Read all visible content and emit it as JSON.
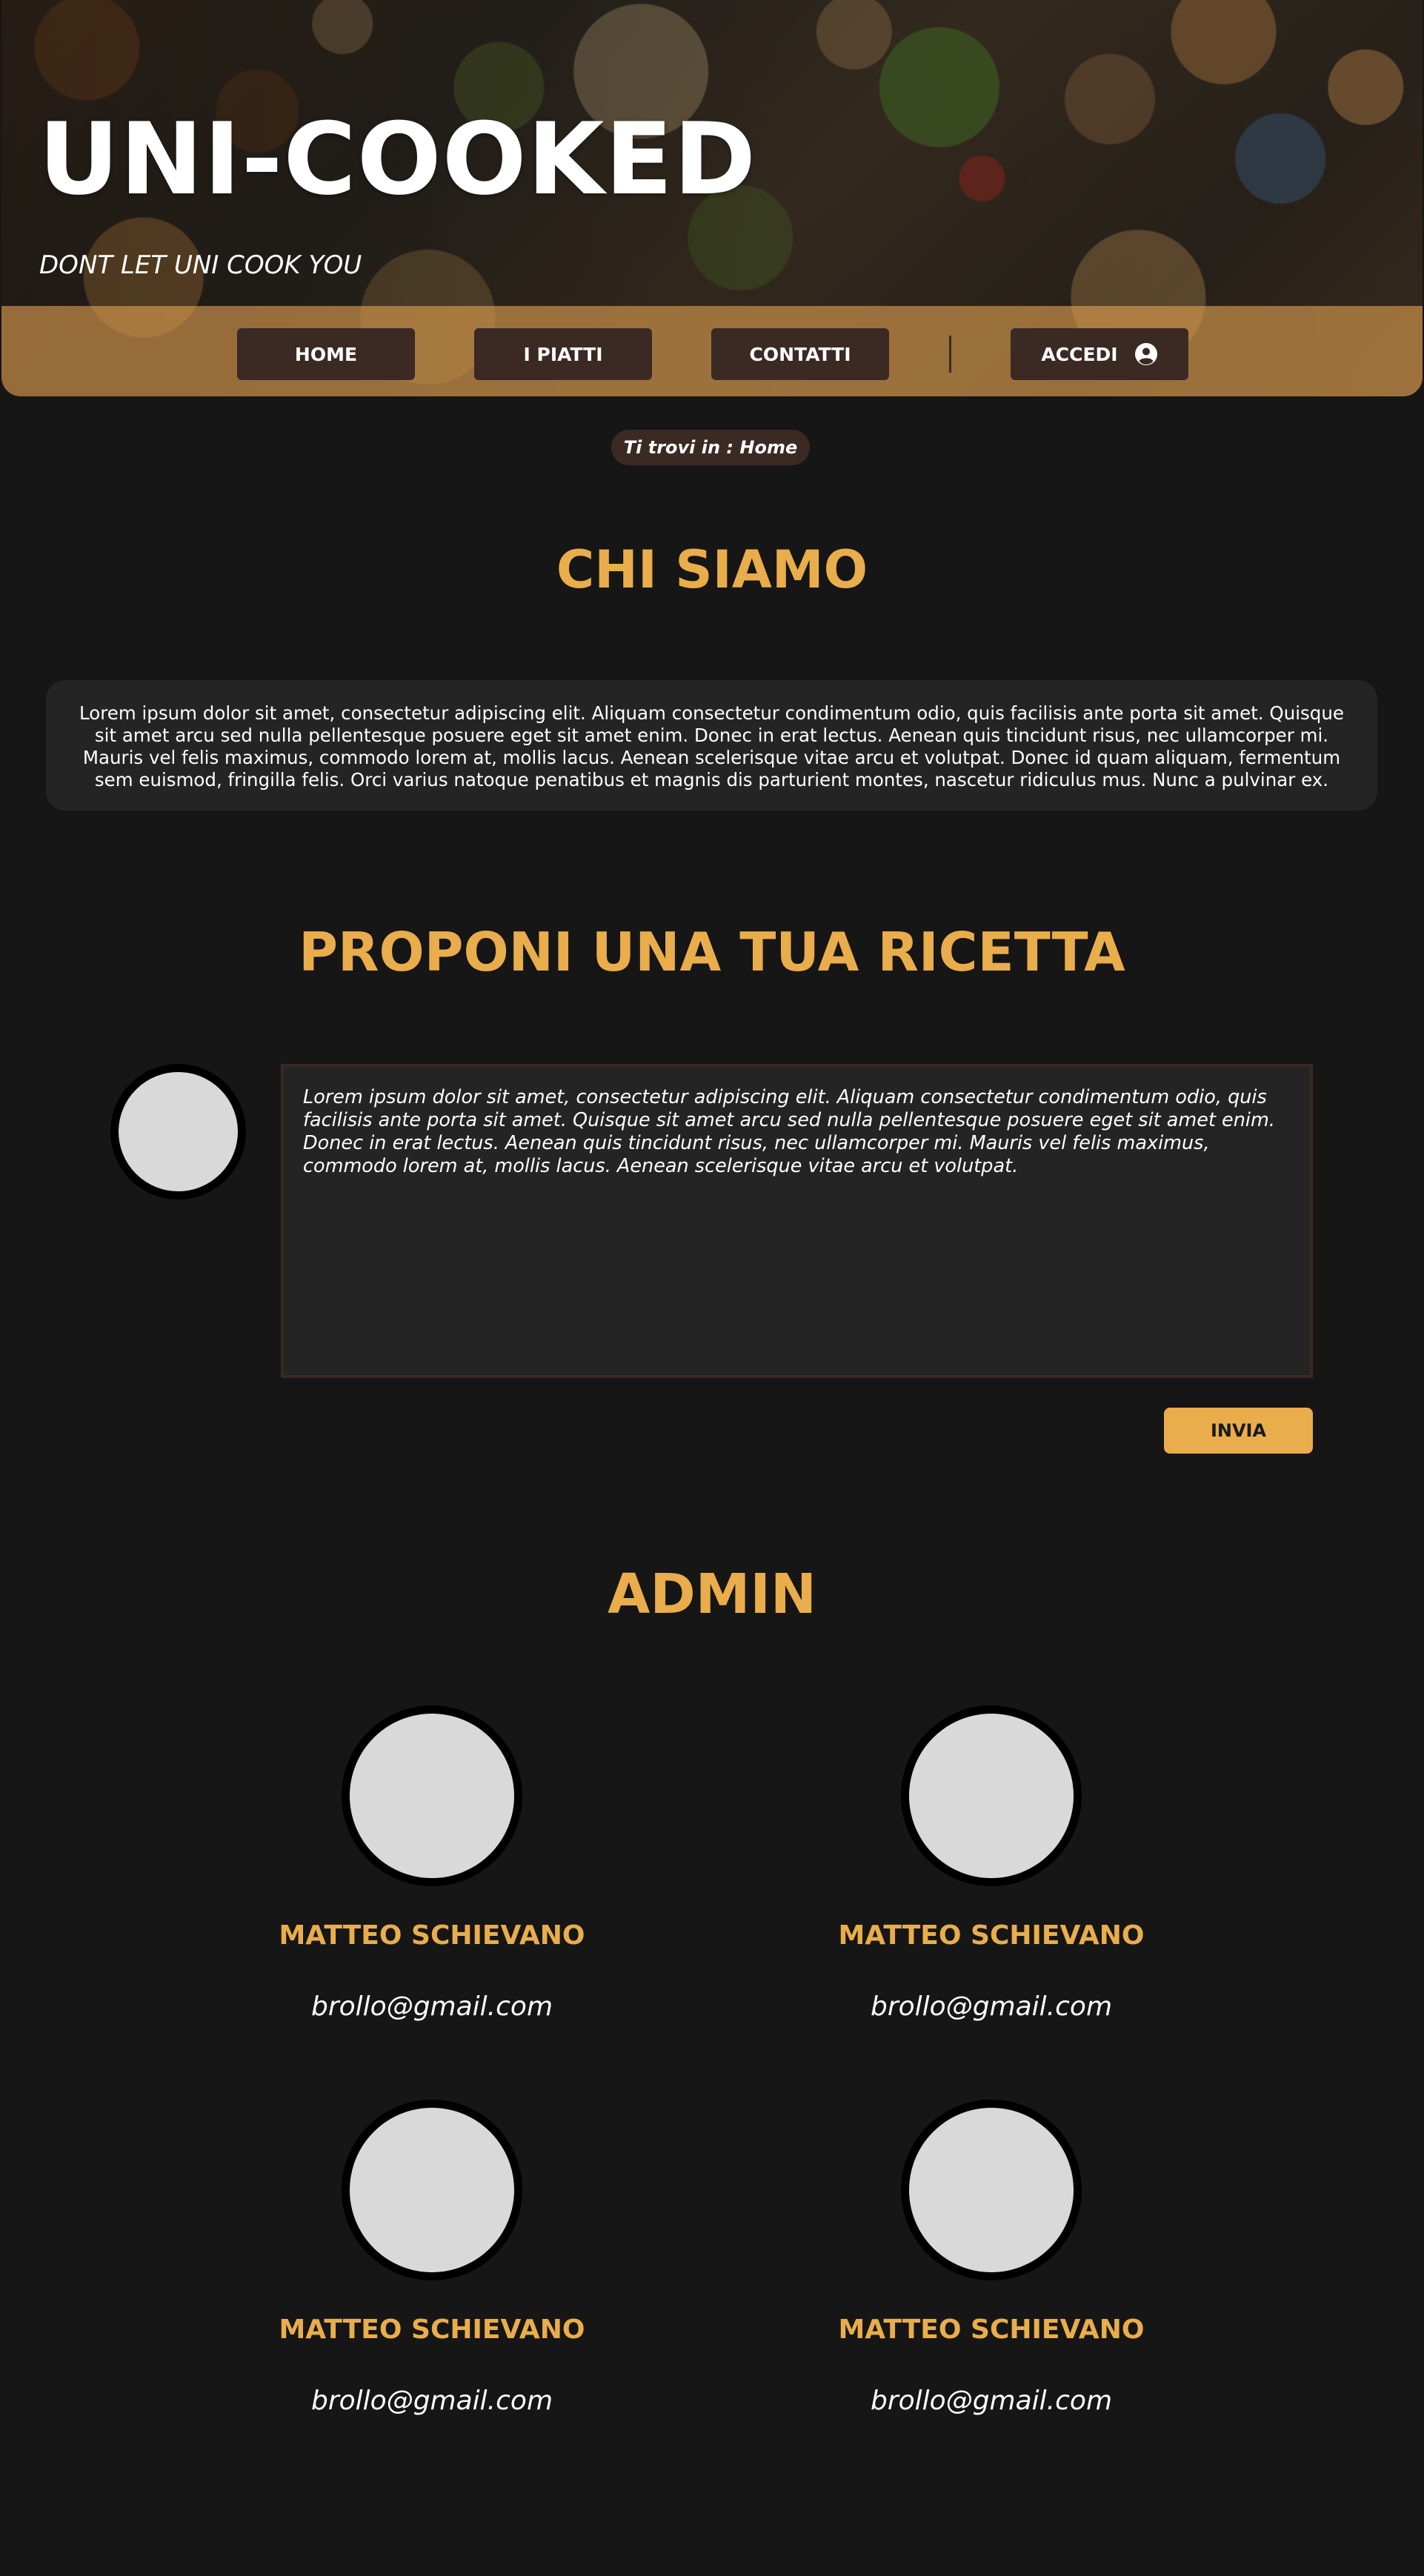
{
  "header": {
    "title": "UNI-COOKED",
    "tagline": "DONT LET UNI COOK YOU"
  },
  "nav": {
    "home": "HOME",
    "dishes": "I PIATTI",
    "contacts": "CONTATTI",
    "login": "ACCEDI"
  },
  "breadcrumb": "Ti trovi in : Home",
  "about": {
    "title": "CHI SIAMO",
    "text": "Lorem ipsum dolor sit amet, consectetur adipiscing elit. Aliquam  consectetur condimentum odio, quis facilisis ante porta sit amet.  Quisque sit amet arcu sed nulla pellentesque posuere eget sit amet enim. Donec in erat lectus. Aenean quis tincidunt risus, nec ullamcorper mi.  Mauris vel felis maximus, commodo lorem at, mollis lacus. Aenean  scelerisque vitae arcu et volutpat. Donec id quam aliquam, fermentum sem euismod, fringilla felis. Orci varius natoque penatibus et magnis dis  parturient montes, nascetur ridiculus mus. Nunc a pulvinar ex."
  },
  "recipe": {
    "title": "PROPONI UNA TUA RICETTA",
    "text": "Lorem ipsum dolor sit amet, consectetur adipiscing elit. Aliquam  consectetur condimentum odio, quis facilisis ante porta sit amet.  Quisque sit amet arcu sed nulla pellentesque posuere eget sit amet enim. Donec in erat lectus. Aenean quis tincidunt risus, nec ullamcorper mi.  Mauris vel felis maximus, commodo lorem at, mollis lacus. Aenean  scelerisque vitae arcu et volutpat.",
    "submit_label": "INVIA"
  },
  "admin": {
    "title": "ADMIN",
    "members": [
      {
        "name": "MATTEO SCHIEVANO",
        "email": "brollo@gmail.com"
      },
      {
        "name": "MATTEO SCHIEVANO",
        "email": "brollo@gmail.com"
      },
      {
        "name": "MATTEO SCHIEVANO",
        "email": "brollo@gmail.com"
      },
      {
        "name": "MATTEO SCHIEVANO",
        "email": "brollo@gmail.com"
      }
    ]
  },
  "icons": {
    "login": "user-circle-icon"
  },
  "colors": {
    "accent": "#e9ad4c",
    "background": "#161616",
    "panel": "#242424",
    "nav_button": "#3b2a24",
    "navbar_overlay": "#e0a050"
  }
}
